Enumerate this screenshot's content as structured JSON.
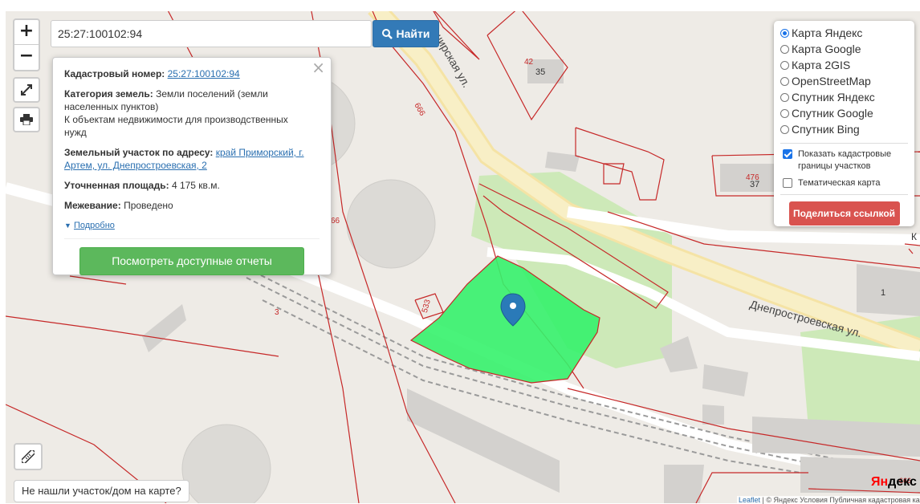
{
  "search": {
    "value": "25:27:100102:94",
    "button_label": "Найти"
  },
  "zoom": {
    "in_label": "+",
    "out_label": "−"
  },
  "popup": {
    "cadastral_label": "Кадастровый номер:",
    "cadastral_value": "25:27:100102:94",
    "category_label": "Категория земель:",
    "category_value": "Земли поселений (земли населенных пунктов)",
    "category_note": "К объектам недвижимости для производственных нужд",
    "address_label": "Земельный участок по адресу:",
    "address_value": "край Приморский, г. Артем, ул. Днепростроевская, 2",
    "area_label": "Уточненная площадь:",
    "area_value": "4 175 кв.м.",
    "survey_label": "Межевание:",
    "survey_value": "Проведено",
    "more_label": "Подробно",
    "reports_button": "Посмотреть доступные отчеты"
  },
  "layers": {
    "options": [
      {
        "label": "Карта Яндекс",
        "selected": true
      },
      {
        "label": "Карта Google",
        "selected": false
      },
      {
        "label": "Карта 2GIS",
        "selected": false
      },
      {
        "label": "OpenStreetMap",
        "selected": false
      },
      {
        "label": "Спутник Яндекс",
        "selected": false
      },
      {
        "label": "Спутник Google",
        "selected": false
      },
      {
        "label": "Спутник Bing",
        "selected": false
      }
    ],
    "show_borders_label": "Показать кадастровые границы участков",
    "show_borders_checked": true,
    "thematic_label": "Тематическая карта",
    "thematic_checked": false,
    "share_button": "Поделиться ссылкой"
  },
  "map_labels": {
    "street_kashirskaya": "Каширская ул.",
    "street_dneprostroevskaya": "Днепростроевская ул.",
    "house_35": "35",
    "parcel_42": "42",
    "parcel_476": "476",
    "house_37": "37",
    "parcel_533": "533",
    "parcel_666": "666",
    "parcel_666b": "66",
    "parcel_3": "3",
    "house_1": "1",
    "edge_k": "К",
    "corner_666": "666"
  },
  "not_found_label": "Не нашли участок/дом на карте?",
  "yandex_logo": {
    "ya": "Ян",
    "rest": "декс"
  },
  "attribution": {
    "leaflet": "Leaflet",
    "text": "© Яндекс Условия Публичная кадастровая карта ©"
  },
  "colors": {
    "parcel_fill": "#35f26b",
    "marker": "#2a7ab8",
    "cadastral_border": "#c62828",
    "search_button": "#337ab7",
    "reports_button": "#5cb85c",
    "share_button": "#d9534f"
  }
}
